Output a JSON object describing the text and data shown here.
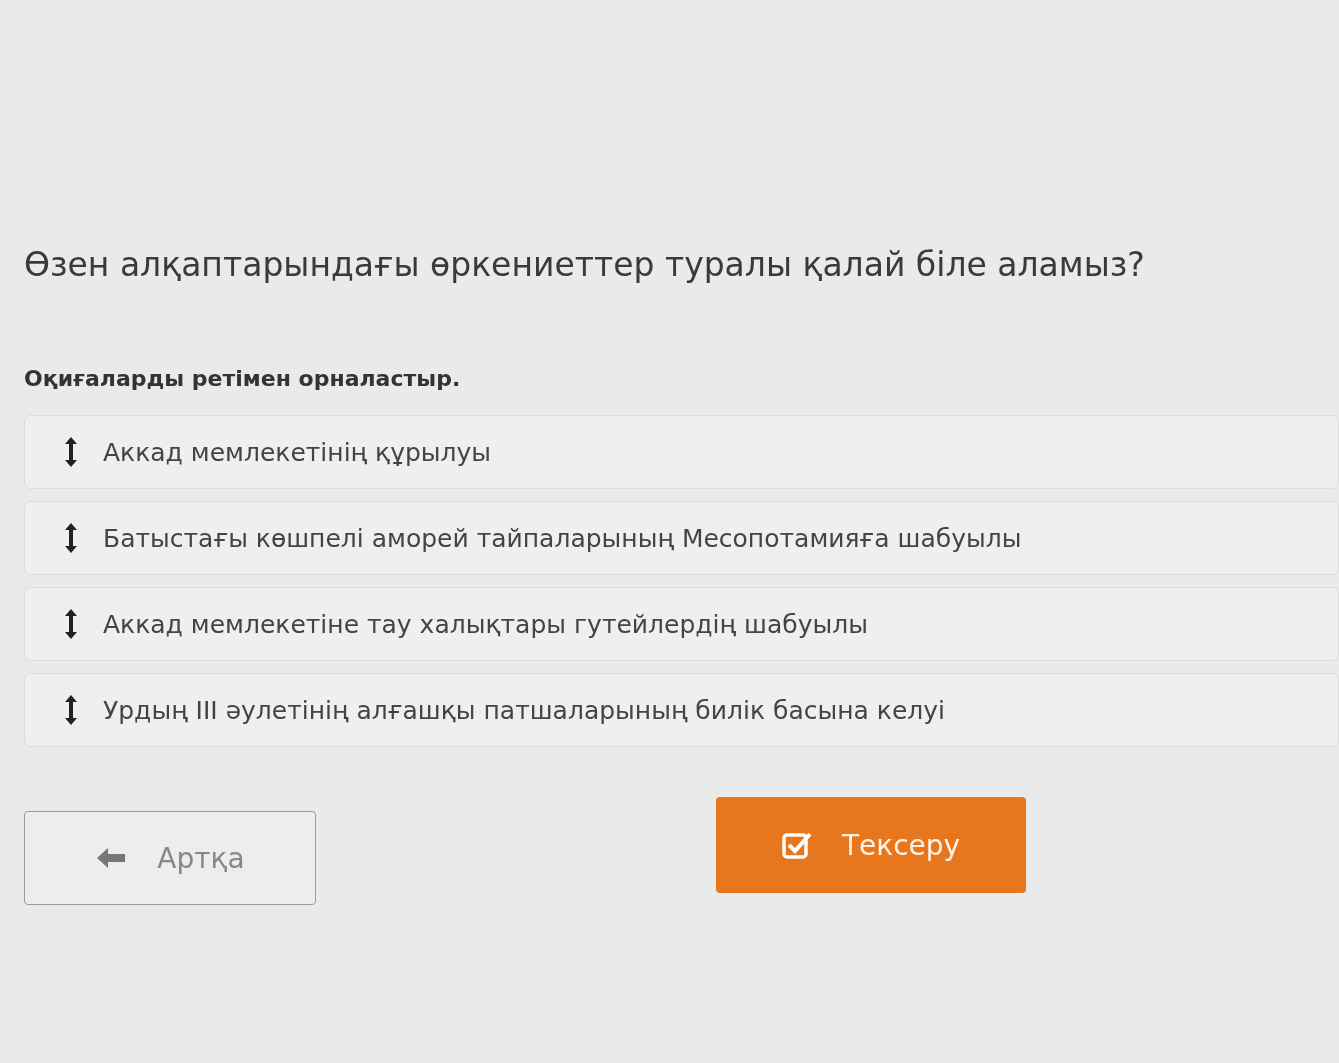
{
  "question": "Өзен алқаптарындағы өркениеттер туралы қалай біле аламыз?",
  "instruction": "Оқиғаларды ретімен орналастыр.",
  "items": [
    {
      "text": "Аккад мемлекетінің құрылуы"
    },
    {
      "text": "Батыстағы көшпелі аморей тайпаларының Месопотамияға шабуылы"
    },
    {
      "text": "Аккад мемлекетіне тау халықтары гутейлердің шабуылы"
    },
    {
      "text": "Урдың III әулетінің алғашқы патшаларының билік басына келуі"
    }
  ],
  "buttons": [
    {
      "kind": "back",
      "label": "Артқа"
    },
    {
      "kind": "check",
      "label": "Тексеру"
    }
  ]
}
